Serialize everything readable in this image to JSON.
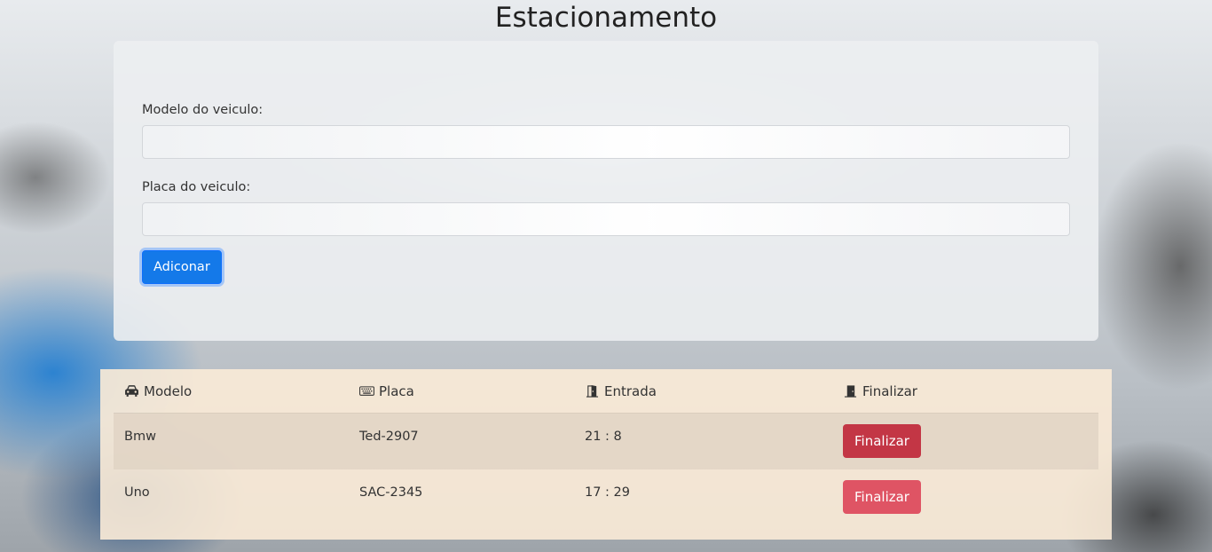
{
  "page": {
    "title": "Estacionamento"
  },
  "form": {
    "model_label": "Modelo do veiculo:",
    "model_value": "",
    "plate_label": "Placa do veiculo:",
    "plate_value": "",
    "add_button": "Adiconar"
  },
  "table": {
    "headers": [
      {
        "icon": "car-icon",
        "label": "Modelo"
      },
      {
        "icon": "keyboard-icon",
        "label": "Placa"
      },
      {
        "icon": "door-open-icon",
        "label": "Entrada"
      },
      {
        "icon": "door-closed-icon",
        "label": "Finalizar"
      }
    ],
    "rows": [
      {
        "model": "Bmw",
        "plate": "Ted-2907",
        "entry": "21 : 8",
        "action": "Finalizar"
      },
      {
        "model": "Uno",
        "plate": "SAC-2345",
        "entry": "17 : 29",
        "action": "Finalizar"
      }
    ]
  },
  "colors": {
    "primary": "#1479e9",
    "danger_active": "#c33645",
    "danger": "#df5464",
    "table_bg": "#fbebd7"
  }
}
